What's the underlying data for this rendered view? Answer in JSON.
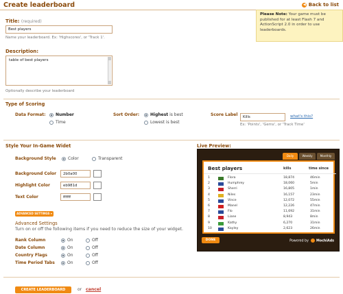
{
  "header": {
    "title": "Create leaderboard",
    "back_label": "Back to list"
  },
  "note": {
    "bold": "Please Note:",
    "text": " Your game must be published for at least Flash 7 and ActionScript 2.0 in order to use leaderboards."
  },
  "title_field": {
    "label": "Title:",
    "required": "(required)",
    "value": "Best players",
    "hint": "Name your leaderboard. Ex: 'Highscores', or 'Track 1'."
  },
  "description_field": {
    "label": "Description:",
    "value": "table of best players",
    "hint": "Optionally describe your leaderboard"
  },
  "scoring": {
    "heading": "Type of Scoring",
    "data_format": {
      "label": "Data Format:",
      "options": [
        "Number",
        "Time"
      ]
    },
    "sort_order": {
      "label": "Sort Order:",
      "options": [
        "Highest",
        "Lowest"
      ],
      "suffix": "is best"
    },
    "score_label": {
      "label": "Score Label",
      "value": "Kills",
      "link": "what's this?",
      "hint": "Ex: 'Points', 'Gems', or 'Track Time'"
    }
  },
  "style": {
    "heading": "Style Your In-Game Widet",
    "bg_style": {
      "label": "Background Style",
      "options": [
        "Color",
        "Transparent"
      ]
    },
    "bg_color": {
      "label": "Background Color",
      "value": "2b0a00"
    },
    "highlight_color": {
      "label": "Highlight Color",
      "value": "eb981d"
    },
    "text_color": {
      "label": "Text Color",
      "value": "ffffff"
    },
    "advanced_button": "ADVANCED SETTINGS"
  },
  "advanced": {
    "heading": "Advanced Settings",
    "text": "Turn on or off the following items if you need to reduce the size of your widget.",
    "on": "On",
    "off": "Off",
    "items": [
      "Rank Column",
      "Date Column",
      "Country Flags",
      "Time Period Tabs"
    ]
  },
  "preview": {
    "heading": "Live Preview:",
    "tabs": [
      "Daily",
      "Weekly",
      "Monthly"
    ],
    "title": "Best players",
    "col_kills": "kills",
    "col_time": "time since",
    "rows": [
      {
        "rank": "1",
        "name": "Flora",
        "kills": "18,874",
        "time": "46min",
        "flag": "#3a7a2a"
      },
      {
        "rank": "2",
        "name": "Humphrey",
        "kills": "18,060",
        "time": "5min",
        "flag": "#2a4a9a"
      },
      {
        "rank": "3",
        "name": "Sherri",
        "kills": "16,805",
        "time": "1min",
        "flag": "#c8202a"
      },
      {
        "rank": "4",
        "name": "Niles",
        "kills": "16,157",
        "time": "23min",
        "flag": "#e0b020"
      },
      {
        "rank": "5",
        "name": "Vince",
        "kills": "12,072",
        "time": "55min",
        "flag": "#2a4a9a"
      },
      {
        "rank": "6",
        "name": "Manel",
        "kills": "12,226",
        "time": "47min",
        "flag": "#d02020"
      },
      {
        "rank": "7",
        "name": "Flo",
        "kills": "11,692",
        "time": "31min",
        "flag": "#2a4a9a"
      },
      {
        "rank": "8",
        "name": "Liane",
        "kills": "8,943",
        "time": "8min",
        "flag": "#c8202a"
      },
      {
        "rank": "9",
        "name": "Kathy",
        "kills": "6,270",
        "time": "31min",
        "flag": "#3a9a3a"
      },
      {
        "rank": "10",
        "name": "Kayley",
        "kills": "2,623",
        "time": "26min",
        "flag": "#2a4a9a"
      }
    ],
    "done": "DONE",
    "powered_by": "Powered by",
    "brand": "MochiAds"
  },
  "footer": {
    "create_button": "CREATE LEADERBOARD",
    "or": "or",
    "cancel": "cancel"
  },
  "colors": {
    "brand_brown": "#8a4a0a",
    "accent_orange": "#f08a12",
    "note_bg": "#fdf3c0",
    "preview_bg": "#2b1d10"
  }
}
